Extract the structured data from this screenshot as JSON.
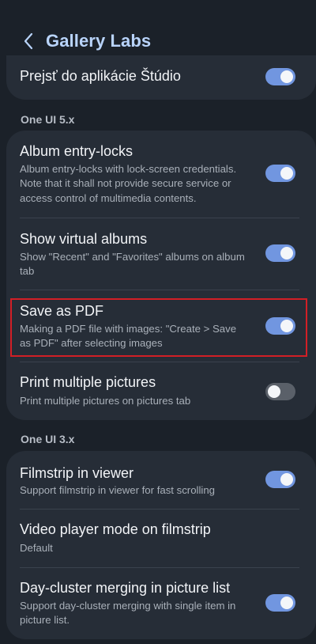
{
  "header": {
    "title": "Gallery Labs",
    "back_icon": "chevron-left-icon"
  },
  "top_item": {
    "title": "Prejsť do aplikácie Štúdio",
    "enabled": true
  },
  "sections": [
    {
      "label": "One UI 5.x",
      "items": [
        {
          "title": "Album entry-locks",
          "subtitle_lines": [
            "Album entry-locks with lock-screen credentials.",
            "Note that it shall not provide secure service or",
            "access control of multimedia contents."
          ],
          "enabled": true
        },
        {
          "title": "Show virtual albums",
          "subtitle_lines": [
            "Show \"Recent\" and \"Favorites\" albums on album",
            "tab"
          ],
          "enabled": true
        },
        {
          "title": "Save as PDF",
          "subtitle_lines": [
            "Making a PDF file with images: \"Create > Save",
            "as PDF\" after selecting images"
          ],
          "enabled": true,
          "highlighted": true
        },
        {
          "title": "Print multiple pictures",
          "subtitle_lines": [
            "Print multiple pictures on pictures tab"
          ],
          "enabled": false
        }
      ]
    },
    {
      "label": "One UI 3.x",
      "items": [
        {
          "title": "Filmstrip in viewer",
          "subtitle_lines": [
            "Support filmstrip in viewer for fast scrolling"
          ],
          "enabled": true
        },
        {
          "title": "Video player mode on filmstrip",
          "subtitle_lines": [
            "Default"
          ],
          "enabled": null
        },
        {
          "title": "Day-cluster merging in picture list",
          "subtitle_lines": [
            "Support day-cluster merging with single item in",
            "picture list."
          ],
          "enabled": true
        }
      ]
    }
  ],
  "colors": {
    "background": "#1b2129",
    "card": "#262d37",
    "title_accent": "#b9d4fb",
    "toggle_on": "#7196e0",
    "toggle_off": "#5a6069",
    "highlight": "#d21f26"
  }
}
